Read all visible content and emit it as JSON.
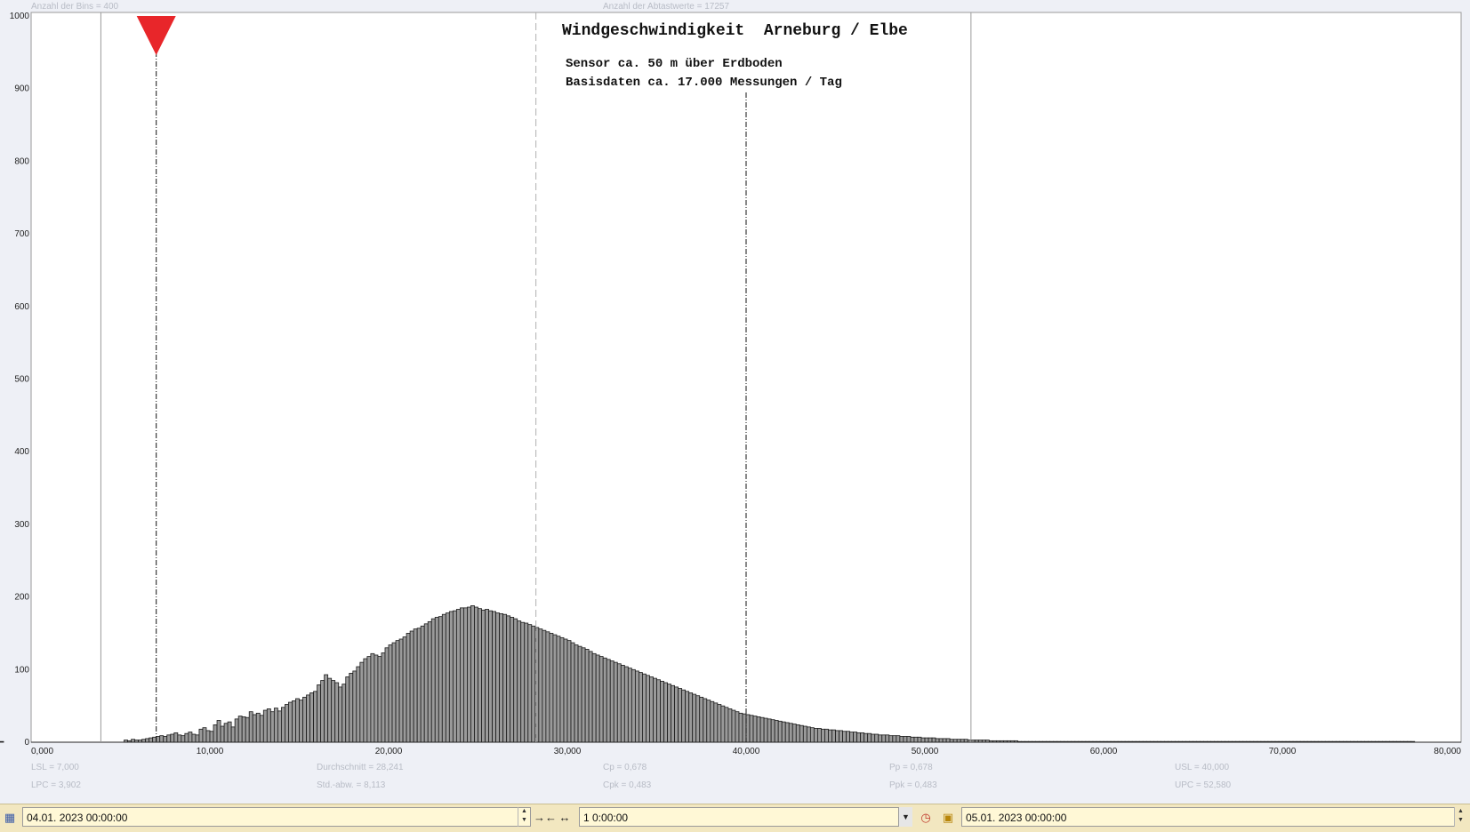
{
  "header": {
    "bins_label": "Anzahl der Bins =   400",
    "samples_label": "Anzahl der Abtastwerte = 17257"
  },
  "annotation": {
    "title": "Windgeschwindigkeit  Arneburg / Elbe",
    "line1": "Sensor ca. 50 m über Erdboden",
    "line2": "Basisdaten ca. 17.000 Messungen / Tag"
  },
  "stats": {
    "lsl": "LSL = 7,000",
    "lpc": "LPC = 3,902",
    "mean": "Durchschnitt  = 28,241",
    "std": "Std.-abw. = 8,113",
    "cp": "Cp  = 0,678",
    "cpk": "Cpk = 0,483",
    "pp": "Pp  = 0,678",
    "ppk": "Ppk = 0,483",
    "usl": "USL = 40,000",
    "upc": "UPC = 52,580"
  },
  "toolbar": {
    "start_date": "04.01. 2023   00:00:00",
    "interval": "1 0:00:00",
    "end_date": "05.01. 2023   00:00:00",
    "calendar_icon": "calendar-icon",
    "shrink_icon": "shrink-arrows-icon",
    "expand_icon": "expand-arrows-icon",
    "clock_icon": "clock-icon",
    "lock_icon": "lock-icon"
  },
  "colors": {
    "bar_fill": "#9a9a9a",
    "bar_stroke": "#1a1a1a",
    "marker": "#e8262a",
    "toolbar_bg": "#f2e7c0"
  },
  "chart_data": {
    "type": "bar",
    "x_ticks": [
      "0,000",
      "10,000",
      "20,000",
      "30,000",
      "40,000",
      "50,000",
      "60,000",
      "70,000",
      "80,000"
    ],
    "y_ticks": [
      "0",
      "100",
      "200",
      "300",
      "400",
      "500",
      "600",
      "700",
      "800",
      "900",
      "1000"
    ],
    "xlim": [
      0,
      80
    ],
    "ylim": [
      0,
      1000
    ],
    "bin_width": 0.2,
    "limit_lines": {
      "lpc": 3.902,
      "lsl": 7.0,
      "mean": 28.241,
      "usl": 40.0,
      "upc": 52.58
    },
    "marker_at": 7.0,
    "series": [
      {
        "bin_start": [
          5.2,
          5.4,
          5.6,
          5.8,
          6.0,
          6.2,
          6.4,
          6.6,
          6.8,
          7.0,
          7.2,
          7.4,
          7.6,
          7.8,
          8.0,
          8.2,
          8.4,
          8.6,
          8.8,
          9.0,
          9.2,
          9.4,
          9.6,
          9.8,
          10.0,
          10.2,
          10.4,
          10.6,
          10.8,
          11.0,
          11.2,
          11.4,
          11.6,
          11.8,
          12.0,
          12.2,
          12.4,
          12.6,
          12.8,
          13.0,
          13.2,
          13.4,
          13.6,
          13.8,
          14.0,
          14.2,
          14.4,
          14.6,
          14.8,
          15.0,
          15.2,
          15.4,
          15.6,
          15.8,
          16.0,
          16.2,
          16.4,
          16.6,
          16.8,
          17.0,
          17.2,
          17.4,
          17.6,
          17.8,
          18.0,
          18.2,
          18.4,
          18.6,
          18.8,
          19.0,
          19.2,
          19.4,
          19.6,
          19.8,
          20.0,
          20.2,
          20.4,
          20.6,
          20.8,
          21.0,
          21.2,
          21.4,
          21.6,
          21.8,
          22.0,
          22.2,
          22.4,
          22.6,
          22.8,
          23.0,
          23.2,
          23.4,
          23.6,
          23.8,
          24.0,
          24.2,
          24.4,
          24.6,
          24.8,
          25.0,
          25.2,
          25.4,
          25.6,
          25.8,
          26.0,
          26.2,
          26.4,
          26.6,
          26.8,
          27.0,
          27.2,
          27.4,
          27.6,
          27.8,
          28.0,
          28.2,
          28.4,
          28.6,
          28.8,
          29.0,
          29.2,
          29.4,
          29.6,
          29.8,
          30.0,
          30.2,
          30.4,
          30.6,
          30.8,
          31.0,
          31.2,
          31.4,
          31.6,
          31.8,
          32.0,
          32.2,
          32.4,
          32.6,
          32.8,
          33.0,
          33.2,
          33.4,
          33.6,
          33.8,
          34.0,
          34.2,
          34.4,
          34.6,
          34.8,
          35.0,
          35.2,
          35.4,
          35.6,
          35.8,
          36.0,
          36.2,
          36.4,
          36.6,
          36.8,
          37.0,
          37.2,
          37.4,
          37.6,
          37.8,
          38.0,
          38.2,
          38.4,
          38.6,
          38.8,
          39.0,
          39.2,
          39.4,
          39.6,
          39.8,
          40.0,
          40.2,
          40.4,
          40.6,
          40.8,
          41.0,
          41.2,
          41.4,
          41.6,
          41.8,
          42.0,
          42.2,
          42.4,
          42.6,
          42.8,
          43.0,
          43.2,
          43.4,
          43.6,
          43.8,
          44.0,
          44.2,
          44.4,
          44.6,
          44.8,
          45.0,
          45.2,
          45.4,
          45.6,
          45.8,
          46.0,
          46.2,
          46.4,
          46.6,
          46.8,
          47.0,
          47.2,
          47.4,
          47.6,
          47.8,
          48.0,
          48.2,
          48.4,
          48.6,
          48.8,
          49.0,
          49.2,
          49.4,
          49.6,
          49.8,
          50.0,
          50.2,
          50.4,
          50.6,
          50.8,
          51.0,
          51.2,
          51.4,
          51.6,
          51.8,
          52.0,
          52.2,
          52.4,
          52.6,
          52.8,
          53.0,
          53.2,
          53.4,
          53.6,
          53.8,
          54.0,
          54.2,
          54.4,
          54.6,
          54.8,
          55.0,
          55.2,
          55.4,
          55.6,
          55.8,
          56.0,
          56.2,
          56.4,
          56.6,
          56.8,
          57.0,
          57.2,
          57.4,
          57.6,
          57.8,
          58.0,
          58.2,
          58.4,
          58.6,
          58.8,
          59.0,
          59.2,
          59.4,
          59.6,
          59.8,
          60.0,
          60.2,
          60.4,
          60.6,
          60.8,
          61.0,
          61.2,
          61.4,
          61.6,
          61.8,
          62.0,
          62.2,
          62.4,
          62.6,
          62.8,
          63.0,
          63.2,
          63.4,
          63.6,
          63.8,
          64.0,
          64.2,
          64.4,
          64.6,
          64.8,
          65.0,
          65.2,
          65.4,
          65.6,
          65.8,
          66.0,
          66.2,
          66.4,
          66.6,
          66.8,
          67.0,
          67.2,
          67.4,
          67.6,
          67.8,
          68.0,
          68.2,
          68.4,
          68.6,
          68.8,
          69.0,
          69.2,
          69.4,
          69.6,
          69.8,
          70.0,
          70.2,
          70.4,
          70.6,
          70.8,
          71.0,
          71.2,
          71.4,
          71.6,
          71.8,
          72.0,
          72.2,
          72.4,
          72.6,
          72.8,
          73.0,
          73.2,
          73.4,
          73.6,
          73.8,
          74.0,
          74.2,
          74.4,
          74.6,
          74.8,
          75.0,
          75.2,
          75.4,
          75.6,
          75.8,
          76.0,
          76.2,
          76.4,
          76.6,
          76.8,
          77.0,
          77.2
        ],
        "values": [
          3,
          2,
          4,
          3,
          3,
          4,
          5,
          6,
          7,
          8,
          9,
          8,
          10,
          11,
          13,
          10,
          9,
          12,
          14,
          11,
          10,
          18,
          20,
          16,
          15,
          24,
          30,
          22,
          26,
          28,
          21,
          32,
          36,
          35,
          34,
          42,
          38,
          40,
          37,
          44,
          46,
          42,
          47,
          43,
          48,
          52,
          55,
          57,
          60,
          58,
          62,
          65,
          68,
          70,
          79,
          85,
          93,
          88,
          85,
          82,
          76,
          80,
          90,
          95,
          98,
          104,
          110,
          115,
          118,
          122,
          120,
          118,
          123,
          130,
          134,
          137,
          140,
          142,
          145,
          150,
          153,
          156,
          157,
          160,
          163,
          166,
          170,
          172,
          173,
          176,
          178,
          180,
          181,
          183,
          185,
          185,
          186,
          188,
          186,
          184,
          182,
          183,
          181,
          180,
          178,
          177,
          176,
          174,
          172,
          170,
          167,
          165,
          164,
          162,
          160,
          158,
          156,
          154,
          152,
          150,
          148,
          146,
          144,
          142,
          140,
          137,
          134,
          132,
          130,
          128,
          125,
          122,
          120,
          118,
          116,
          114,
          112,
          110,
          108,
          106,
          104,
          102,
          100,
          98,
          96,
          94,
          92,
          90,
          88,
          86,
          84,
          82,
          80,
          78,
          76,
          74,
          72,
          70,
          68,
          66,
          64,
          62,
          60,
          58,
          56,
          54,
          52,
          50,
          48,
          46,
          44,
          42,
          40,
          39,
          38,
          37,
          36,
          35,
          34,
          33,
          32,
          31,
          30,
          29,
          28,
          27,
          26,
          25,
          24,
          23,
          22,
          21,
          20,
          19,
          19,
          18,
          18,
          17,
          17,
          16,
          16,
          15,
          15,
          14,
          14,
          13,
          13,
          12,
          12,
          11,
          11,
          10,
          10,
          10,
          9,
          9,
          9,
          8,
          8,
          8,
          7,
          7,
          7,
          6,
          6,
          6,
          6,
          5,
          5,
          5,
          5,
          4,
          4,
          4,
          4,
          4,
          3,
          3,
          3,
          3,
          3,
          3,
          2,
          2,
          2,
          2,
          2,
          2,
          2,
          2,
          1,
          1,
          1,
          1,
          1,
          1,
          1,
          1,
          1,
          1,
          1,
          1,
          1,
          1,
          1,
          1,
          1,
          1,
          1,
          1,
          1,
          1,
          1,
          1,
          1,
          1,
          1,
          1,
          1,
          1,
          1,
          1,
          1,
          1,
          1,
          1,
          1,
          1,
          1,
          1,
          1,
          1,
          1,
          1,
          1,
          1,
          1,
          1,
          1,
          1,
          1,
          1,
          1,
          1,
          1,
          1,
          1,
          1,
          1,
          1,
          1,
          1,
          1,
          1,
          1,
          1,
          1,
          1,
          1,
          1,
          1,
          1,
          1,
          1,
          1,
          1,
          1,
          1,
          1,
          1,
          1,
          1,
          1,
          1,
          1,
          1,
          1,
          1,
          1,
          1,
          1,
          1,
          1,
          1,
          1,
          1,
          1,
          1,
          1,
          1,
          1,
          1,
          1,
          1,
          1,
          1,
          1,
          1,
          1,
          1,
          1,
          1
        ]
      }
    ]
  }
}
